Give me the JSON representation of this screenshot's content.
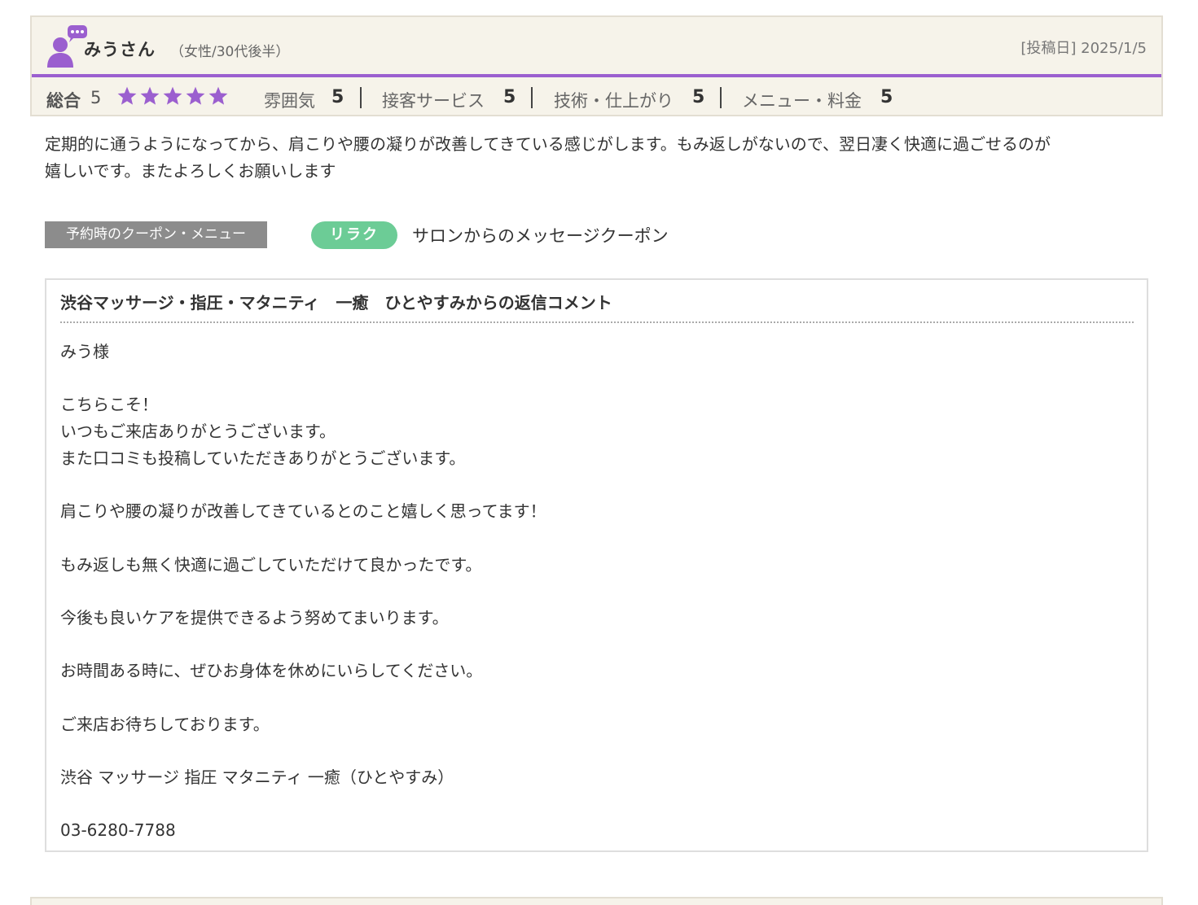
{
  "review": {
    "user_name": "みうさん",
    "user_meta": "（女性/30代後半）",
    "post_date": "[投稿日] 2025/1/5",
    "scores": {
      "total_label": "総合",
      "total_value": "5",
      "stars": 5,
      "atmosphere_label": "雰囲気",
      "atmosphere_value": "5",
      "service_label": "接客サービス",
      "service_value": "5",
      "skill_label": "技術・仕上がり",
      "skill_value": "5",
      "price_label": "メニュー・料金",
      "price_value": "5"
    },
    "body_lines": [
      "定期的に通うようになってから、肩こりや腰の凝りが改善してきている感じがします。もみ返しがないので、翌日凄く快適に過ごせるのが",
      "嬉しいです。またよろしくお願いします"
    ],
    "coupon": {
      "label": "予約時のクーポン・メニュー",
      "badge": "リラク",
      "name": "サロンからのメッセージクーポン"
    }
  },
  "reply": {
    "title": "渋谷マッサージ・指圧・マタニティ　一癒　ひとやすみからの返信コメント",
    "lines": [
      "みう様",
      "",
      "こちらこそ！",
      "いつもご来店ありがとうございます。",
      "また口コミも投稿していただきありがとうございます。",
      "",
      "肩こりや腰の凝りが改善してきているとのこと嬉しく思ってます！",
      "",
      "もみ返しも無く快適に過ごしていただけて良かったです。",
      "",
      "今後も良いケアを提供できるよう努めてまいります。",
      "",
      "お時間ある時に、ぜひお身体を休めにいらしてください。",
      "",
      "ご来店お待ちしております。",
      "",
      "渋谷 マッサージ 指圧 マタニティ 一癒（ひとやすみ）",
      "",
      "03-6280-7788"
    ]
  },
  "colors": {
    "accent_purple": "#9b5fcf",
    "header_bg": "#f6f3ea",
    "badge_green": "#6ccc96",
    "label_gray": "#8c8c8c"
  },
  "icons": {
    "avatar": "user-speech-bubble-icon",
    "star": "star-icon"
  }
}
